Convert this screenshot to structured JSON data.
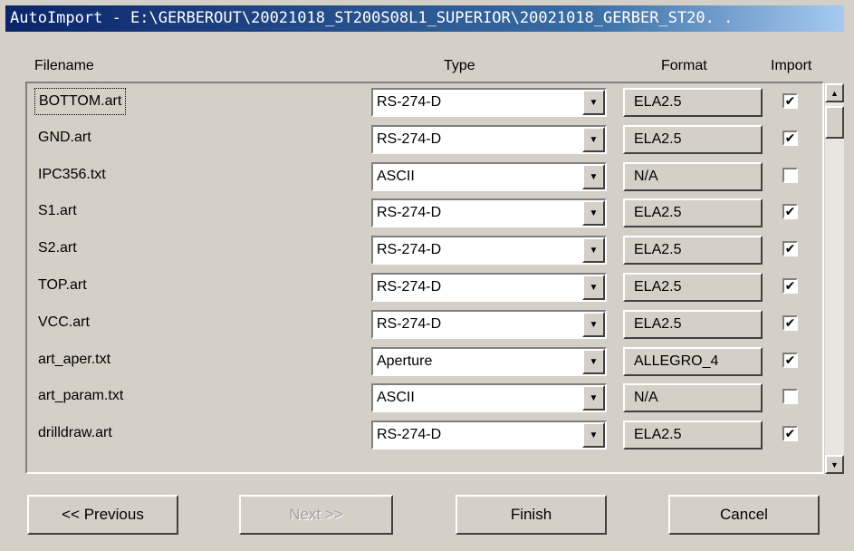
{
  "window": {
    "title": "AutoImport - E:\\GERBEROUT\\20021018_ST200S08L1_SUPERIOR\\20021018_GERBER_ST20. ."
  },
  "headers": {
    "filename": "Filename",
    "type": "Type",
    "format": "Format",
    "import": "Import"
  },
  "rows": [
    {
      "filename": "BOTTOM.art",
      "type": "RS-274-D",
      "format": "ELA2.5",
      "import": true,
      "focused": true
    },
    {
      "filename": "GND.art",
      "type": "RS-274-D",
      "format": "ELA2.5",
      "import": true
    },
    {
      "filename": "IPC356.txt",
      "type": "ASCII",
      "format": "N/A",
      "import": false
    },
    {
      "filename": "S1.art",
      "type": "RS-274-D",
      "format": "ELA2.5",
      "import": true
    },
    {
      "filename": "S2.art",
      "type": "RS-274-D",
      "format": "ELA2.5",
      "import": true
    },
    {
      "filename": "TOP.art",
      "type": "RS-274-D",
      "format": "ELA2.5",
      "import": true
    },
    {
      "filename": "VCC.art",
      "type": "RS-274-D",
      "format": "ELA2.5",
      "import": true
    },
    {
      "filename": "art_aper.txt",
      "type": "Aperture",
      "format": "ALLEGRO_4",
      "import": true
    },
    {
      "filename": "art_param.txt",
      "type": "ASCII",
      "format": "N/A",
      "import": false
    },
    {
      "filename": "drilldraw.art",
      "type": "RS-274-D",
      "format": "ELA2.5",
      "import": true
    }
  ],
  "buttons": {
    "previous": "<< Previous",
    "next": "Next >>",
    "finish": "Finish",
    "cancel": "Cancel"
  },
  "icons": {
    "dropdown": "chevron-down-icon",
    "check": "checkmark-icon",
    "scroll_up": "scroll-up-arrow-icon",
    "scroll_down": "scroll-down-arrow-icon"
  },
  "colors": {
    "titlebar_start": "#0a246a",
    "titlebar_end": "#a6caf0",
    "face": "#d4d0c8"
  }
}
